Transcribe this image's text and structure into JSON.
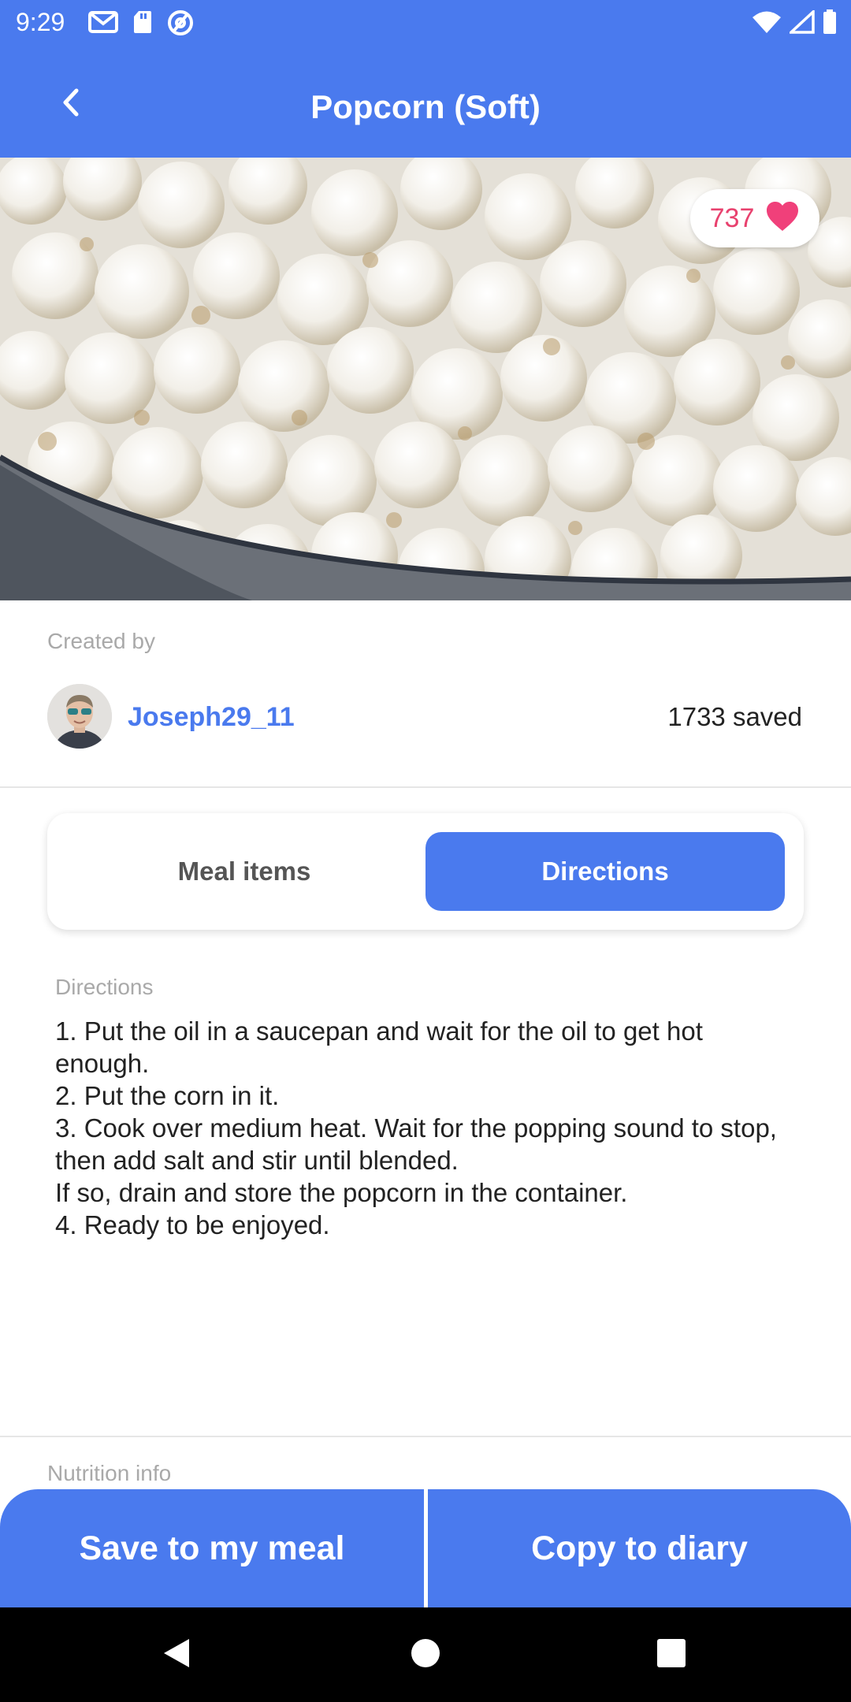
{
  "status_bar": {
    "time": "9:29",
    "left_icons": [
      "gmail-icon",
      "sd-card-icon",
      "at-sign-icon"
    ],
    "right_icons": [
      "wifi-icon",
      "cell-signal-icon",
      "battery-icon"
    ]
  },
  "app_bar": {
    "title": "Popcorn (Soft)",
    "back_icon": "chevron-left-icon"
  },
  "hero": {
    "likes": "737",
    "like_icon": "heart-icon",
    "heart_color": "#f0407a"
  },
  "creator": {
    "label": "Created by",
    "name": "Joseph29_11",
    "saved": "1733 saved"
  },
  "tabs": [
    {
      "label": "Meal items",
      "selected": false
    },
    {
      "label": "Directions",
      "selected": true
    }
  ],
  "directions": {
    "label": "Directions",
    "lines": [
      "1. Put the oil in a saucepan and wait for the oil to get hot enough.",
      "2. Put the corn in it.",
      "3. Cook over medium heat. Wait for the popping sound to stop, then add salt and stir until blended.",
      "If so, drain and store the popcorn in the container.",
      "4. Ready to be enjoyed."
    ]
  },
  "nutrition": {
    "label": "Nutrition info"
  },
  "actions": {
    "save_label": "Save to my meal",
    "copy_label": "Copy to diary"
  },
  "nav_bar": {
    "icons": [
      "back-triangle-icon",
      "home-circle-icon",
      "recents-square-icon"
    ]
  },
  "colors": {
    "accent": "#4a7aee",
    "heart": "#f0407a",
    "muted_text": "#a9a9a9"
  }
}
